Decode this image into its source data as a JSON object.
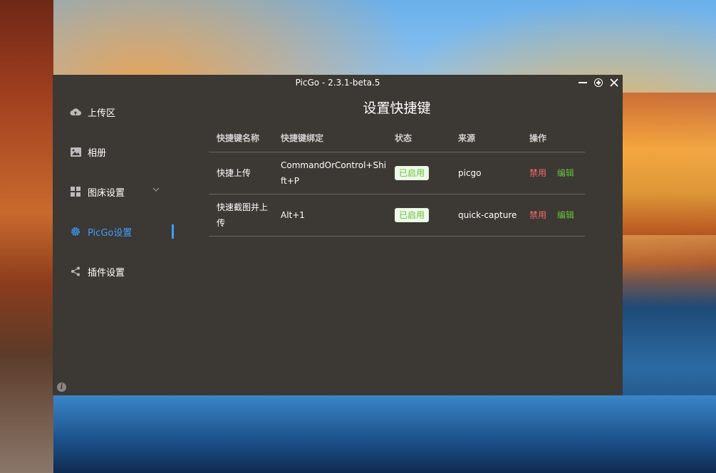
{
  "window": {
    "title": "PicGo - 2.3.1-beta.5"
  },
  "sidebar": {
    "items": [
      {
        "label": "上传区",
        "icon": "upload-cloud-icon"
      },
      {
        "label": "相册",
        "icon": "image-icon"
      },
      {
        "label": "图床设置",
        "icon": "grid-icon"
      },
      {
        "label": "PicGo设置",
        "icon": "gear-icon",
        "active": true
      },
      {
        "label": "插件设置",
        "icon": "share-icon"
      }
    ]
  },
  "main": {
    "title": "设置快捷键",
    "table": {
      "headers": [
        "快捷键名称",
        "快捷键绑定",
        "状态",
        "来源",
        "操作"
      ],
      "rows": [
        {
          "name": "快捷上传",
          "binding": "CommandOrControl+Shift+P",
          "status": "已启用",
          "source": "picgo",
          "disable": "禁用",
          "edit": "编辑"
        },
        {
          "name": "快速截图并上传",
          "binding": "Alt+1",
          "status": "已启用",
          "source": "quick-capture",
          "disable": "禁用",
          "edit": "编辑"
        }
      ]
    }
  },
  "colors": {
    "accent": "#409eff",
    "success": "#67c23a",
    "danger": "#f56c6c",
    "window_bg": "#3c3834"
  }
}
